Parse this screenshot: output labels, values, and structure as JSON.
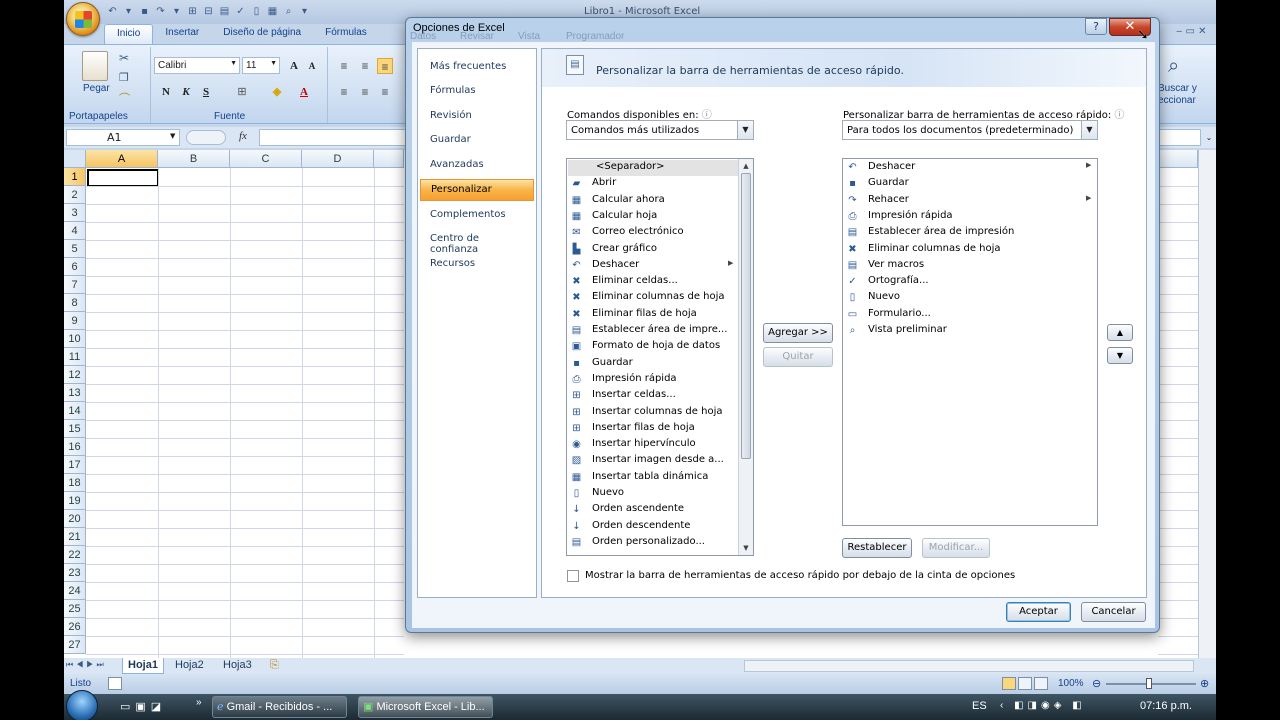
{
  "window": {
    "title": "Libro1 - Microsoft Excel"
  },
  "ribbon": {
    "tabs": [
      "Inicio",
      "Insertar",
      "Diseño de página",
      "Fórmulas"
    ],
    "paste_label": "Pegar",
    "font_name": "Calibri",
    "font_size": "11",
    "groups": {
      "clipboard": "Portapapeles",
      "font": "Fuente"
    },
    "right_label_1": "Buscar y",
    "right_label_2": "eccionar"
  },
  "formula_bar": {
    "name_box": "A1",
    "fx": "fx"
  },
  "grid": {
    "columns": [
      "A",
      "B",
      "C",
      "D"
    ],
    "rows": [
      "1",
      "2",
      "3",
      "4",
      "5",
      "6",
      "7",
      "8",
      "9",
      "10",
      "11",
      "12",
      "13",
      "14",
      "15",
      "16",
      "17",
      "18",
      "19",
      "20",
      "21",
      "22",
      "23",
      "24",
      "25",
      "26",
      "27"
    ]
  },
  "sheets": {
    "tabs": [
      "Hoja1",
      "Hoja2",
      "Hoja3"
    ],
    "active": "Hoja1"
  },
  "status": {
    "text": "Listo",
    "zoom": "100%"
  },
  "taskbar": {
    "items": [
      "Gmail - Recibidos - ...",
      "Microsoft Excel - Lib..."
    ],
    "lang": "ES",
    "time": "07:16 p.m."
  },
  "dialog": {
    "title": "Opciones de Excel",
    "ghost_tabs": [
      "Datos",
      "Revisar",
      "Vista",
      "Programador"
    ],
    "help": "?",
    "close": "✕",
    "nav": [
      "Más frecuentes",
      "Fórmulas",
      "Revisión",
      "Guardar",
      "Avanzadas",
      "Personalizar",
      "Complementos",
      "Centro de confianza",
      "Recursos"
    ],
    "nav_active": "Personalizar",
    "header": "Personalizar la barra de herramientas de acceso rápido.",
    "left_label": "Comandos disponibles en:",
    "left_select": "Comandos más utilizados",
    "right_label": "Personalizar barra de herramientas de acceso rápido:",
    "right_select": "Para todos los documentos (predeterminado)",
    "available_commands": [
      {
        "label": "<Separador>",
        "icon": "separator"
      },
      {
        "label": "Abrir",
        "icon": "open-folder-icon"
      },
      {
        "label": "Calcular ahora",
        "icon": "calculator-icon"
      },
      {
        "label": "Calcular hoja",
        "icon": "calculator-sheet-icon"
      },
      {
        "label": "Correo electrónico",
        "icon": "mail-icon"
      },
      {
        "label": "Crear gráfico",
        "icon": "chart-icon"
      },
      {
        "label": "Deshacer",
        "icon": "undo-icon"
      },
      {
        "label": "Eliminar celdas...",
        "icon": "delete-cells-icon"
      },
      {
        "label": "Eliminar columnas de hoja",
        "icon": "delete-columns-icon"
      },
      {
        "label": "Eliminar filas de hoja",
        "icon": "delete-rows-icon"
      },
      {
        "label": "Establecer área de impre...",
        "icon": "print-area-icon"
      },
      {
        "label": "Formato de hoja de datos",
        "icon": "format-sheet-icon"
      },
      {
        "label": "Guardar",
        "icon": "save-icon"
      },
      {
        "label": "Impresión rápida",
        "icon": "printer-icon"
      },
      {
        "label": "Insertar celdas...",
        "icon": "insert-cells-icon"
      },
      {
        "label": "Insertar columnas de hoja",
        "icon": "insert-columns-icon"
      },
      {
        "label": "Insertar filas de hoja",
        "icon": "insert-rows-icon"
      },
      {
        "label": "Insertar hipervínculo",
        "icon": "hyperlink-icon"
      },
      {
        "label": "Insertar imagen desde a...",
        "icon": "insert-image-icon"
      },
      {
        "label": "Insertar tabla dinámica",
        "icon": "pivot-table-icon"
      },
      {
        "label": "Nuevo",
        "icon": "new-document-icon"
      },
      {
        "label": "Orden ascendente",
        "icon": "sort-ascending-icon"
      },
      {
        "label": "Orden descendente",
        "icon": "sort-descending-icon"
      },
      {
        "label": "Orden personalizado...",
        "icon": "custom-sort-icon"
      }
    ],
    "qat_commands": [
      {
        "label": "Deshacer",
        "icon": "undo-icon"
      },
      {
        "label": "Guardar",
        "icon": "save-icon"
      },
      {
        "label": "Rehacer",
        "icon": "redo-icon"
      },
      {
        "label": "Impresión rápida",
        "icon": "printer-icon"
      },
      {
        "label": "Establecer área de impresión",
        "icon": "print-area-icon"
      },
      {
        "label": "Eliminar columnas de hoja",
        "icon": "delete-columns-icon"
      },
      {
        "label": "Ver macros",
        "icon": "macros-icon"
      },
      {
        "label": "Ortografía...",
        "icon": "spelling-icon"
      },
      {
        "label": "Nuevo",
        "icon": "new-document-icon"
      },
      {
        "label": "Formulario...",
        "icon": "form-icon"
      },
      {
        "label": "Vista preliminar",
        "icon": "print-preview-icon"
      }
    ],
    "add_button": "Agregar >>",
    "remove_button": "Quitar",
    "reset_button": "Restablecer",
    "modify_button": "Modificar...",
    "checkbox_label": "Mostrar la barra de herramientas de acceso rápido por debajo de la cinta de opciones",
    "ok_button": "Aceptar",
    "cancel_button": "Cancelar"
  }
}
